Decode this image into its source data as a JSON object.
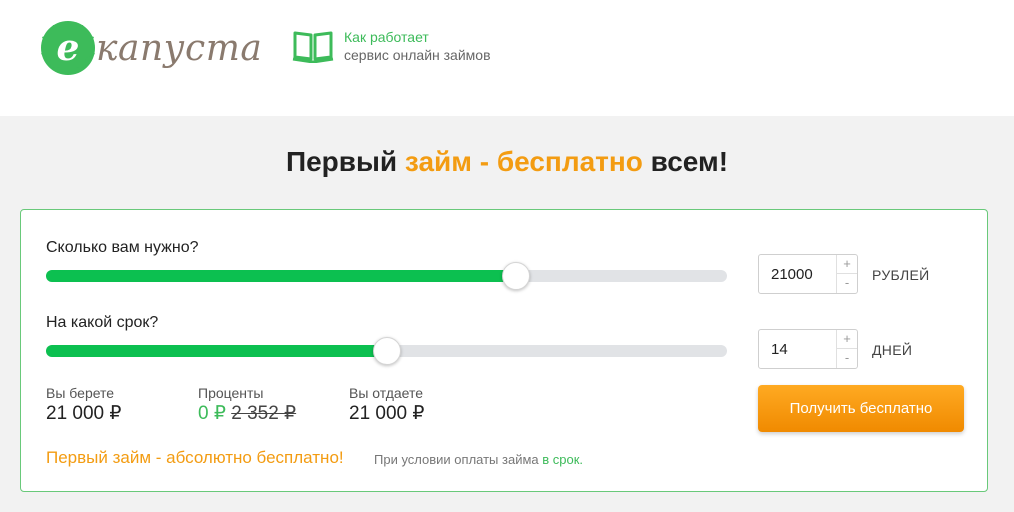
{
  "header": {
    "logo_text": "капуста",
    "how_it_works": {
      "line1": "Как работает",
      "line2": "сервис онлайн займов"
    }
  },
  "headline": {
    "part1": "Первый ",
    "accent": "займ - бесплатно",
    "part2": " всем!"
  },
  "calculator": {
    "amount": {
      "label": "Сколько вам нужно?",
      "value": "21000",
      "unit": "РУБЛЕЙ",
      "slider_fraction": 0.69
    },
    "term": {
      "label": "На какой срок?",
      "value": "14",
      "unit": "ДНЕЙ",
      "slider_fraction": 0.5
    },
    "stepper_plus": "+",
    "stepper_minus": "-",
    "summary": {
      "take_label": "Вы берете",
      "take_value": "21 000 ₽",
      "interest_label": "Проценты",
      "interest_value": "0 ₽",
      "interest_old": "2 352 ₽",
      "return_label": "Вы отдаете",
      "return_value": "21 000 ₽"
    },
    "cta_label": "Получить бесплатно",
    "promo_text": "Первый займ - абсолютно бесплатно!",
    "condition_text": "При условии оплаты займа ",
    "condition_link": "в срок."
  },
  "colors": {
    "brand_green": "#3dbb5a",
    "accent_orange": "#f39c12",
    "slider_fill": "#0cc050"
  },
  "icons": {
    "logo": "kapusta-logo-icon",
    "book": "book-icon"
  }
}
